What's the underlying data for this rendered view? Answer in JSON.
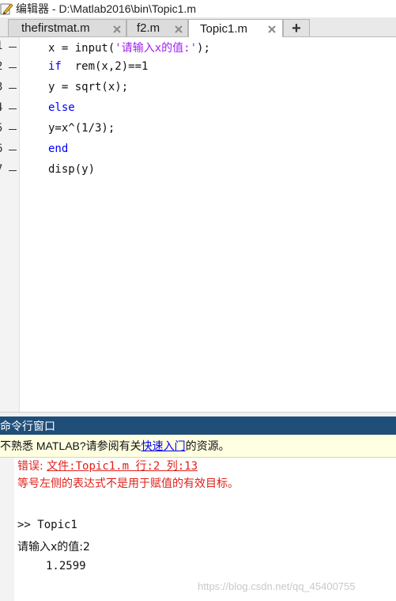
{
  "window": {
    "title": "编辑器 - D:\\Matlab2016\\bin\\Topic1.m"
  },
  "tabs": [
    {
      "label": "thefirstmat.m",
      "active": false
    },
    {
      "label": "f2.m",
      "active": false
    },
    {
      "label": "Topic1.m",
      "active": true
    }
  ],
  "tab_add_label": "+",
  "editor": {
    "lines": [
      {
        "num": "1",
        "parts": [
          {
            "t": "x = input("
          },
          {
            "t": "'请输入x的值:'",
            "c": "str"
          },
          {
            "t": ");"
          }
        ]
      },
      {
        "num": "2",
        "parts": [
          {
            "t": "if",
            "c": "kw"
          },
          {
            "t": "  rem(x,2)==1"
          }
        ]
      },
      {
        "num": "3",
        "parts": [
          {
            "t": "y = sqrt(x);"
          }
        ]
      },
      {
        "num": "4",
        "parts": [
          {
            "t": "else",
            "c": "kw"
          }
        ]
      },
      {
        "num": "5",
        "parts": [
          {
            "t": "y=x^(1/3);"
          }
        ]
      },
      {
        "num": "6",
        "parts": [
          {
            "t": "end",
            "c": "kw"
          }
        ]
      },
      {
        "num": "7",
        "parts": [
          {
            "t": "disp(y)"
          }
        ]
      }
    ]
  },
  "command_window": {
    "title": "命令行窗口",
    "notice_before": "不熟悉 MATLAB?请参阅有关",
    "notice_link": "快速入门",
    "notice_after": "的资源。",
    "error_prefix": "错误: ",
    "error_file_link": "文件:Topic1.m 行:2 列:13",
    "error_message": "等号左侧的表达式不是用于赋值的有效目标。",
    "prompt_line": ">> Topic1",
    "input_line": "请输入x的值:2",
    "output_value": "1.2599"
  },
  "watermark": "https://blog.csdn.net/qq_45400755",
  "colors": {
    "keyword": "#0000ff",
    "string": "#a020f0",
    "error": "#e0201b",
    "header": "#1f4e79",
    "notice_bg": "#ffffe1"
  }
}
